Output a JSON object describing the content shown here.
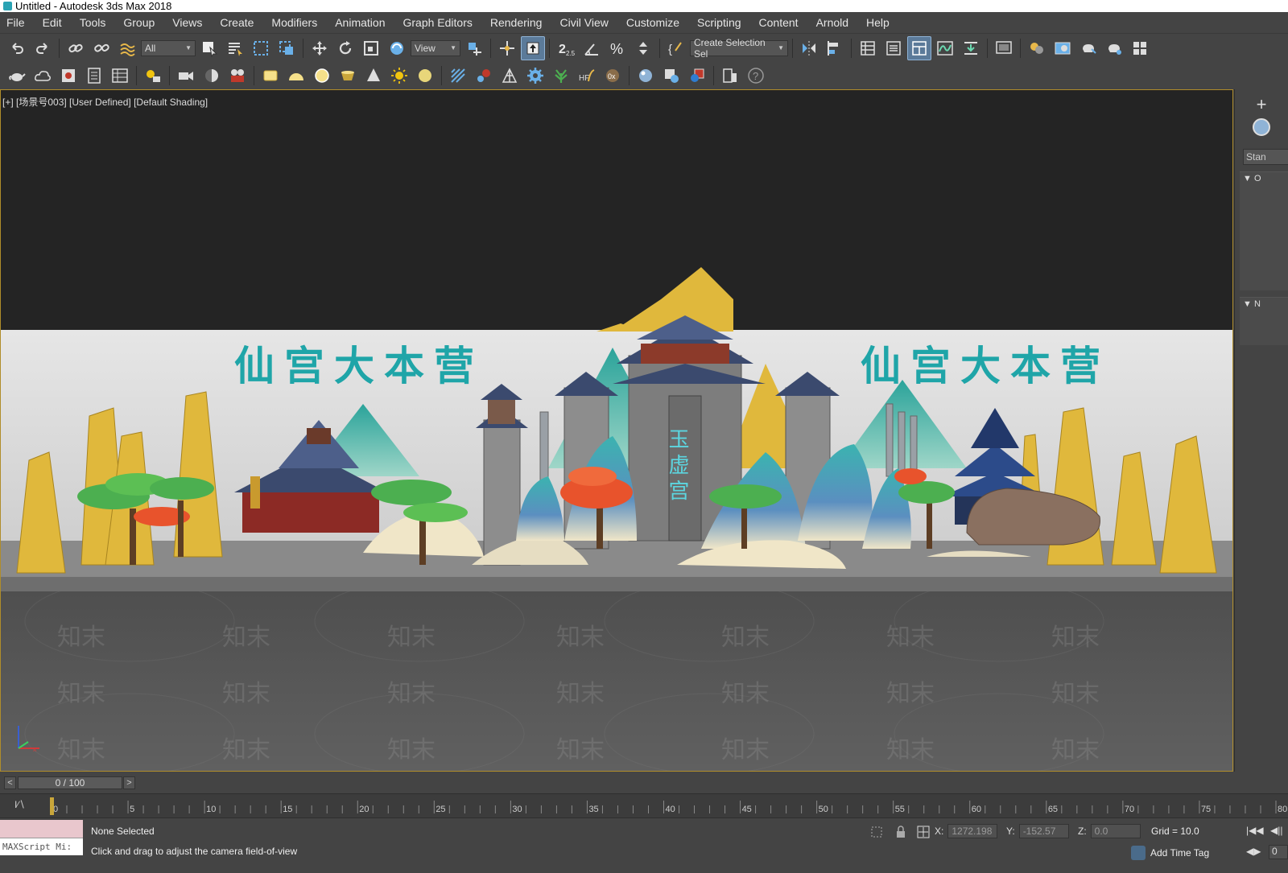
{
  "window": {
    "title": "Untitled - Autodesk 3ds Max 2018"
  },
  "menu": [
    "File",
    "Edit",
    "Tools",
    "Group",
    "Views",
    "Create",
    "Modifiers",
    "Animation",
    "Graph Editors",
    "Rendering",
    "Civil View",
    "Customize",
    "Scripting",
    "Content",
    "Arnold",
    "Help"
  ],
  "toolbar": {
    "selection_filter": "All",
    "ref_coord": "View",
    "snap_angle_label": "2.5",
    "named_selection_placeholder": "Create Selection Sel"
  },
  "viewport": {
    "label": "[+] [场景号003] [User Defined] [Default Shading]",
    "scene_banner_left": "仙宫大本营",
    "scene_banner_right": "仙宫大本营",
    "gate_sign": "玉虚宫",
    "watermark": "知末",
    "axis_label": "x"
  },
  "command_panel": {
    "dropdown": "Stan",
    "rollout1": "O",
    "rollout2": "N"
  },
  "timeline": {
    "frame_display": "0 / 100",
    "ticks": [
      "0",
      "5",
      "10",
      "15",
      "20",
      "25",
      "30",
      "35",
      "40",
      "45",
      "50",
      "55",
      "60",
      "65",
      "70",
      "75",
      "80"
    ]
  },
  "status": {
    "maxscript_label": "MAXScript Mi:",
    "selection": "None Selected",
    "prompt": "Click and drag to adjust the camera field-of-view",
    "x_label": "X:",
    "x_value": "1272.198",
    "y_label": "Y:",
    "y_value": "-152.57",
    "z_label": "Z:",
    "z_value": "0.0",
    "grid": "Grid = 10.0",
    "add_time_tag": "Add Time Tag",
    "frame_field": "0"
  },
  "colors": {
    "ui_bg": "#444444",
    "viewport_border": "#b08d2a",
    "banner_text": "#1fa5a8",
    "mountain_gold": "#e0b83c",
    "active_button": "#5b7a99"
  }
}
